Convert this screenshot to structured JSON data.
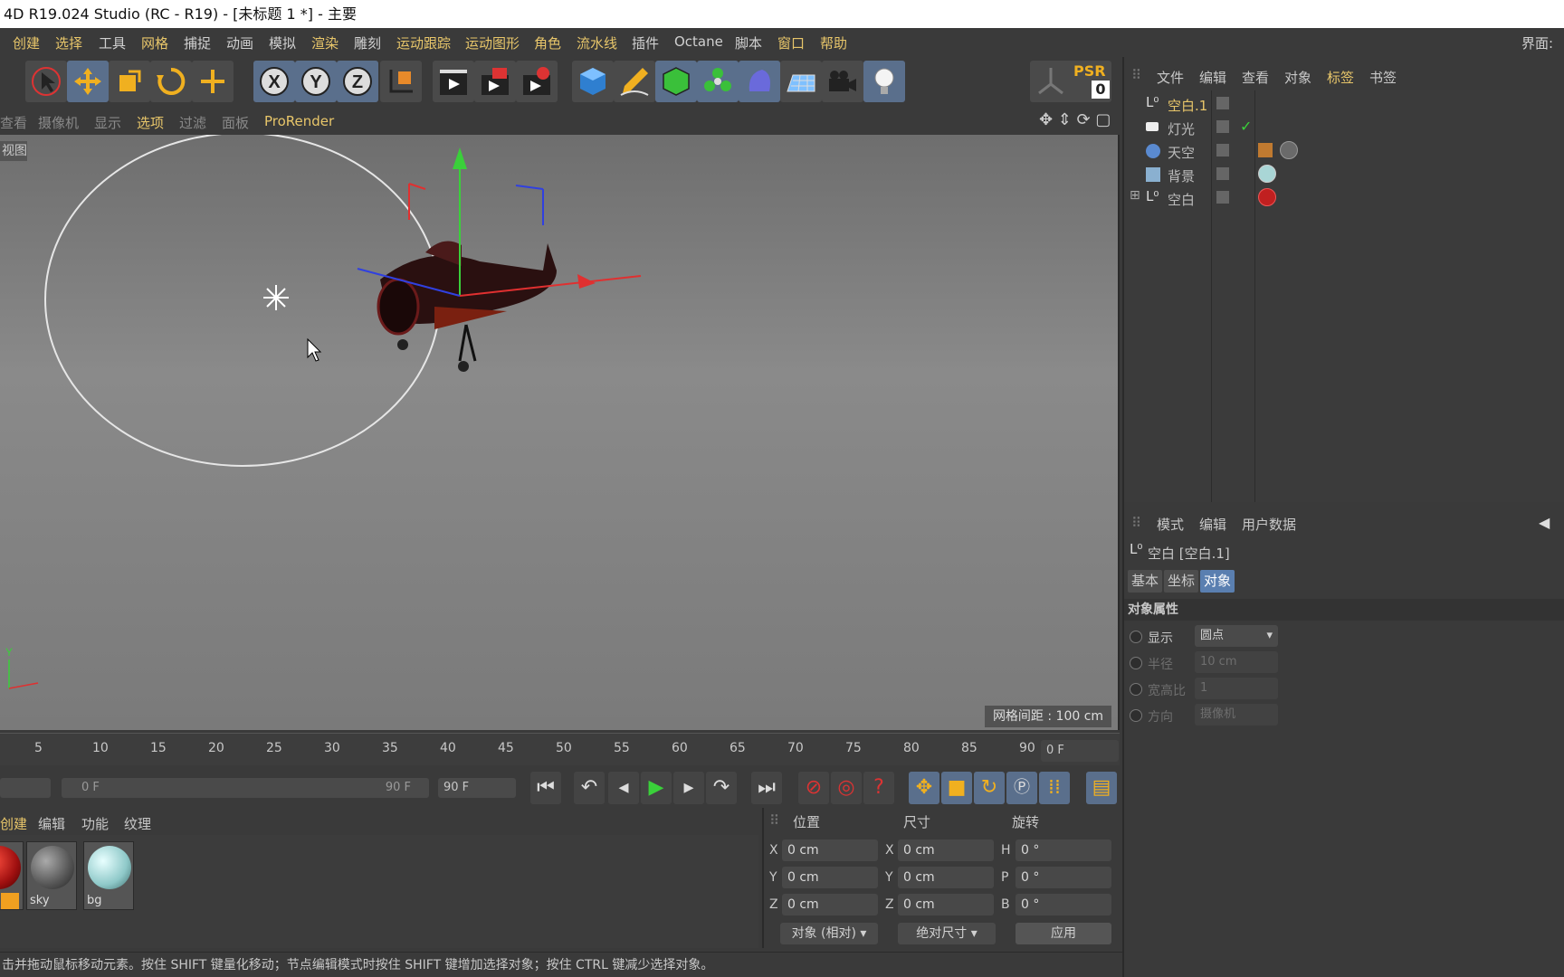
{
  "window": {
    "title": "4D R19.024 Studio (RC - R19) - [未标题 1 *] - 主要"
  },
  "menubar": {
    "items": [
      "创建",
      "选择",
      "工具",
      "网格",
      "捕捉",
      "动画",
      "模拟",
      "渲染",
      "雕刻",
      "运动跟踪",
      "运动图形",
      "角色",
      "流水线",
      "插件",
      "Octane",
      "脚本",
      "窗口",
      "帮助"
    ],
    "layout_label": "界面:"
  },
  "toolbar": {
    "icons": [
      "select-arrow-icon",
      "move-icon",
      "scale-icon",
      "rotate-icon",
      "move-alt-icon",
      "x-axis-icon",
      "y-axis-icon",
      "z-axis-icon",
      "coordinate-system-icon",
      "render-view-icon",
      "render-picture-icon",
      "render-settings-icon",
      "cube-icon",
      "pen-icon",
      "subdivide-icon",
      "cloner-icon",
      "deformer-icon",
      "floor-icon",
      "camera-icon",
      "light-icon"
    ],
    "axis_labels": [
      "X",
      "Y",
      "Z"
    ],
    "psr_label": "PSR",
    "psr_value": "0"
  },
  "viewport": {
    "menu": [
      "查看",
      "摄像机",
      "显示",
      "选项",
      "过滤",
      "面板",
      "ProRender"
    ],
    "label": "视图",
    "grid_spacing": "网格间距 : 100 cm",
    "axis_y": "Y"
  },
  "objects_panel": {
    "menu": [
      "文件",
      "编辑",
      "查看",
      "对象",
      "标签",
      "书签"
    ],
    "objects": [
      {
        "name": "空白.1",
        "selected": true,
        "check": false
      },
      {
        "name": "灯光",
        "selected": false,
        "check": true
      },
      {
        "name": "天空",
        "selected": false,
        "check": false
      },
      {
        "name": "背景",
        "selected": false,
        "check": false
      },
      {
        "name": "空白",
        "selected": false,
        "check": false
      }
    ]
  },
  "attributes_panel": {
    "menu": [
      "模式",
      "编辑",
      "用户数据"
    ],
    "title": "空白 [空白.1]",
    "tabs": [
      "基本",
      "坐标",
      "对象"
    ],
    "active_tab": "对象",
    "section": "对象属性",
    "fields": [
      {
        "label": "显示",
        "value": "圆点",
        "enabled": true
      },
      {
        "label": "半径",
        "value": "10 cm",
        "enabled": false
      },
      {
        "label": "宽高比",
        "value": "1",
        "enabled": false
      },
      {
        "label": "方向",
        "value": "摄像机",
        "enabled": false
      }
    ]
  },
  "timeline": {
    "ticks": [
      "5",
      "10",
      "15",
      "20",
      "25",
      "30",
      "35",
      "40",
      "45",
      "50",
      "55",
      "60",
      "65",
      "70",
      "75",
      "80",
      "85",
      "90"
    ],
    "current_frame": "0 F",
    "range_start": "0 F",
    "range_end": "90 F",
    "end_frame": "90 F"
  },
  "materials": {
    "menu": [
      "创建",
      "编辑",
      "功能",
      "纹理"
    ],
    "items": [
      {
        "name": "",
        "color": "#b02020"
      },
      {
        "name": "sky",
        "color": "#6a6a6a"
      },
      {
        "name": "bg",
        "color": "#a9d6d6"
      }
    ]
  },
  "coordinates": {
    "headers": [
      "位置",
      "尺寸",
      "旋转"
    ],
    "rows": [
      {
        "pos_label": "X",
        "pos": "0 cm",
        "size_label": "X",
        "size": "0 cm",
        "rot_label": "H",
        "rot": "0 °"
      },
      {
        "pos_label": "Y",
        "pos": "0 cm",
        "size_label": "Y",
        "size": "0 cm",
        "rot_label": "P",
        "rot": "0 °"
      },
      {
        "pos_label": "Z",
        "pos": "0 cm",
        "size_label": "Z",
        "size": "0 cm",
        "rot_label": "B",
        "rot": "0 °"
      }
    ],
    "mode": "对象 (相对)",
    "size_mode": "绝对尺寸",
    "apply": "应用"
  },
  "status": {
    "text": "击并拖动鼠标移动元素。按住 SHIFT 键量化移动；节点编辑模式时按住 SHIFT 键增加选择对象；按住 CTRL 键减少选择对象。"
  },
  "colors": {
    "accent": "#e8c66a",
    "selected_tab": "#5a7fb0",
    "toolbar_on": "#5a6f8c"
  }
}
